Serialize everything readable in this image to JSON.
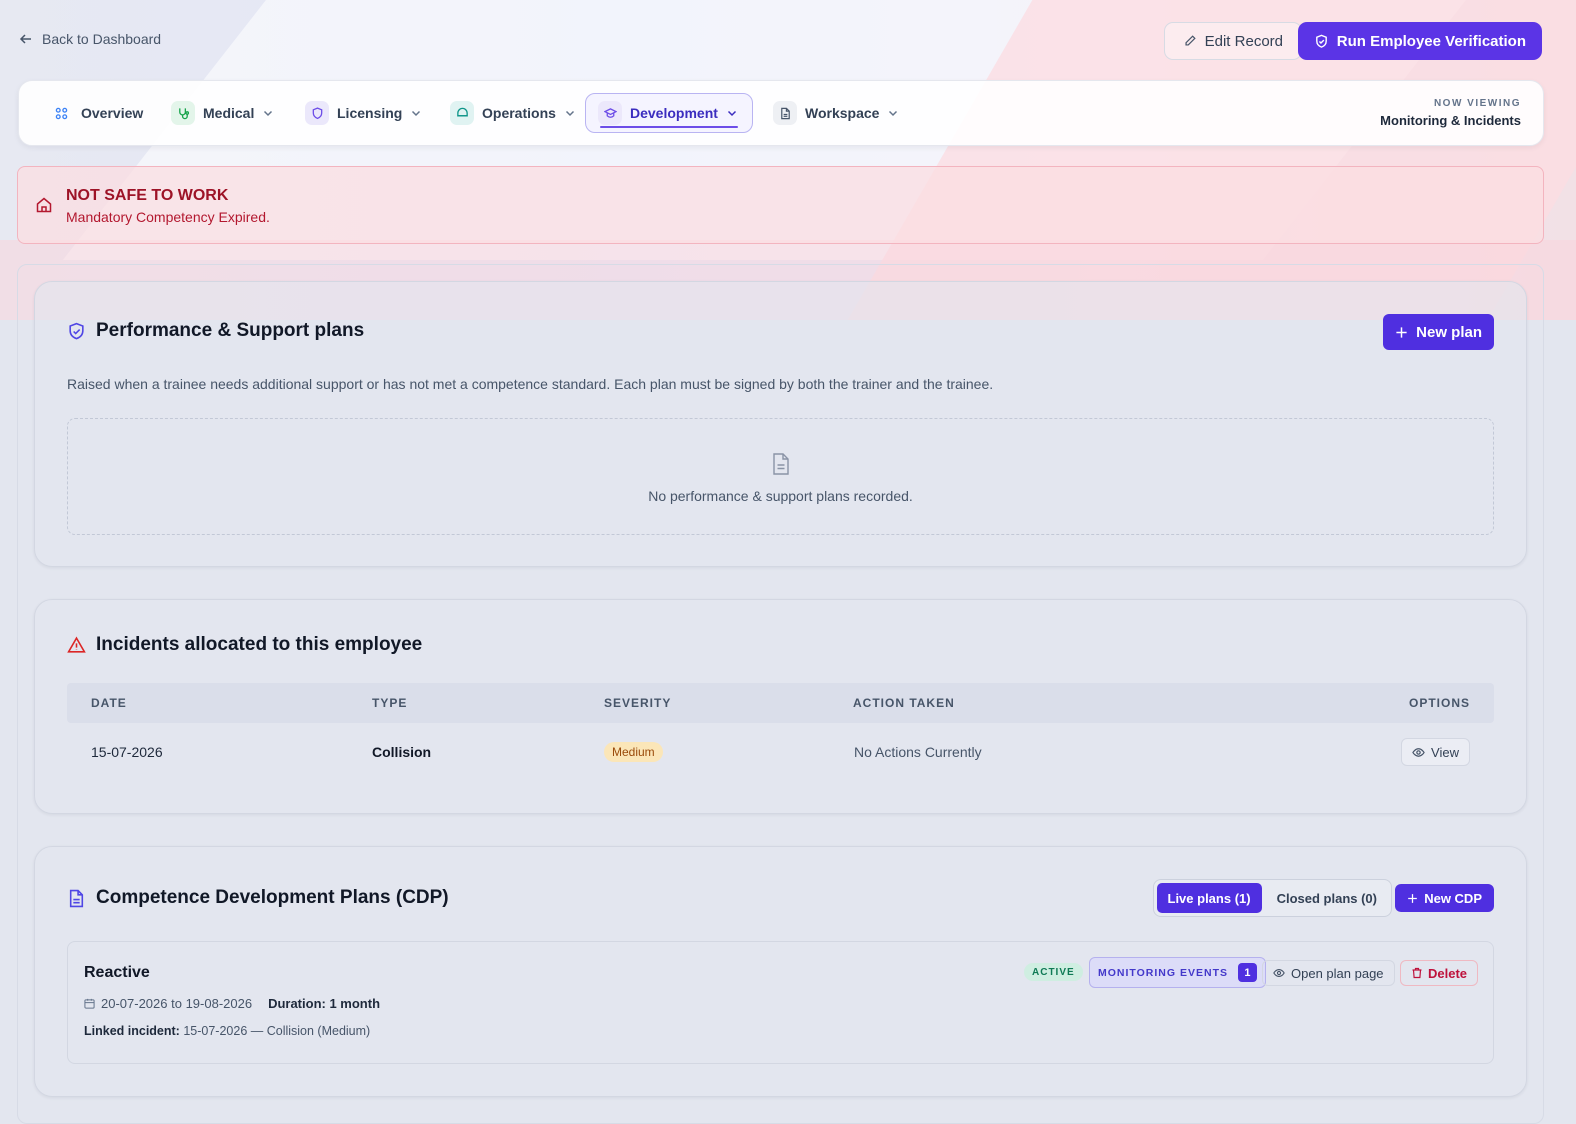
{
  "header": {
    "back_label": "Back to Dashboard",
    "edit_label": "Edit Record",
    "verify_label": "Run Employee Verification"
  },
  "nav": {
    "tabs": [
      {
        "label": "Overview",
        "icon": "grid-icon"
      },
      {
        "label": "Medical",
        "icon": "stethoscope-icon"
      },
      {
        "label": "Licensing",
        "icon": "shield-icon"
      },
      {
        "label": "Operations",
        "icon": "cap-icon"
      },
      {
        "label": "Development",
        "icon": "graduation-cap-icon",
        "active": true
      },
      {
        "label": "Workspace",
        "icon": "document-icon"
      }
    ],
    "viewing_label": "NOW VIEWING",
    "viewing_value": "Monitoring & Incidents"
  },
  "alert": {
    "title": "NOT SAFE TO WORK",
    "message": "Mandatory Competency Expired.",
    "icon": "house-icon",
    "color": "#9d1327"
  },
  "performance": {
    "title": "Performance & Support plans",
    "new_label": "New plan",
    "description": "Raised when a trainee needs additional support or has not met a competence standard. Each plan must be signed by both the trainer and the trainee.",
    "empty_text": "No performance & support plans recorded."
  },
  "incidents": {
    "title": "Incidents allocated to this employee",
    "columns": [
      "DATE",
      "TYPE",
      "SEVERITY",
      "ACTION TAKEN",
      "OPTIONS"
    ],
    "rows": [
      {
        "date": "15-07-2026",
        "type": "Collision",
        "severity": "Medium",
        "action": "No Actions Currently",
        "option": "View"
      }
    ]
  },
  "cdp": {
    "title": "Competence Development Plans (CDP)",
    "live_label": "Live plans (1)",
    "closed_label": "Closed plans (0)",
    "new_label": "New CDP",
    "plan": {
      "title": "Reactive",
      "dates": "20-07-2026 to 19-08-2026",
      "duration_label": "Duration:",
      "duration_value": "1 month",
      "linked_label": "Linked incident:",
      "linked_value": "15-07-2026 — Collision (Medium)",
      "status": "ACTIVE",
      "monitoring_label": "MONITORING EVENTS",
      "monitoring_count": "1",
      "open_label": "Open plan page",
      "delete_label": "Delete"
    }
  },
  "colors": {
    "accent": "#4f2fe0",
    "danger": "#be123c"
  }
}
